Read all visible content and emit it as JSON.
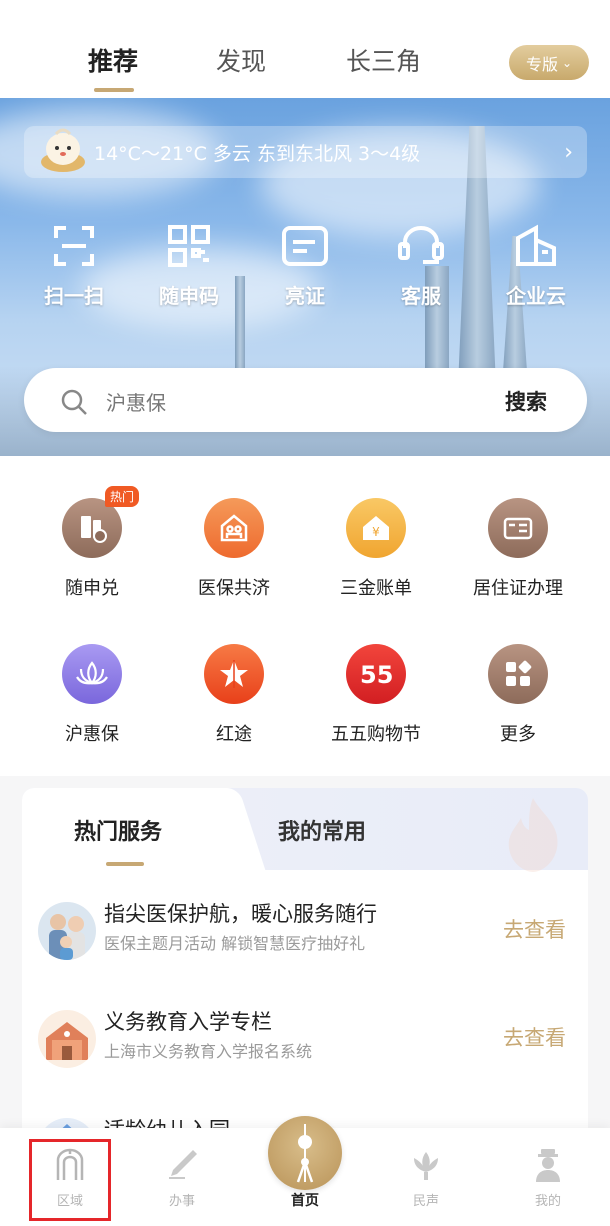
{
  "top_tabs": [
    {
      "label": "推荐",
      "active": true
    },
    {
      "label": "发现",
      "active": false
    },
    {
      "label": "长三角",
      "active": false
    }
  ],
  "edition_button": "专版",
  "weather": {
    "text": "14°C～21°C 多云 东到东北风 3～4级"
  },
  "quick_actions": [
    {
      "label": "扫一扫",
      "icon": "scan-icon"
    },
    {
      "label": "随申码",
      "icon": "qrcode-icon"
    },
    {
      "label": "亮证",
      "icon": "id-card-icon"
    },
    {
      "label": "客服",
      "icon": "customer-service-icon"
    },
    {
      "label": "企业云",
      "icon": "building-icon"
    }
  ],
  "search": {
    "placeholder": "沪惠保",
    "button": "搜索"
  },
  "services": [
    {
      "label": "随申兑",
      "icon": "voucher-icon",
      "badge": "热门",
      "color": "#9b7a66"
    },
    {
      "label": "医保共济",
      "icon": "family-care-icon",
      "color": "#f07a3c"
    },
    {
      "label": "三金账单",
      "icon": "yuan-house-icon",
      "color": "#f3b03b"
    },
    {
      "label": "居住证办理",
      "icon": "residence-card-icon",
      "color": "#9b7a66"
    },
    {
      "label": "沪惠保",
      "icon": "lotus-icon",
      "color": "#8c7be6"
    },
    {
      "label": "红途",
      "icon": "red-star-icon",
      "color": "#ef4b1f"
    },
    {
      "label": "五五购物节",
      "icon": "shopping-festival-icon",
      "color": "#e8302f"
    },
    {
      "label": "更多",
      "icon": "more-grid-icon",
      "color": "#9b7a66"
    }
  ],
  "card": {
    "tabs": [
      {
        "label": "热门服务"
      },
      {
        "label": "我的常用"
      }
    ],
    "items": [
      {
        "title": "指尖医保护航，暖心服务随行",
        "subtitle": "医保主题月活动 解锁智慧医疗抽好礼",
        "action": "去查看"
      },
      {
        "title": "义务教育入学专栏",
        "subtitle": "上海市义务教育入学报名系统",
        "action": "去查看"
      },
      {
        "title": "适龄幼儿入园",
        "subtitle": "",
        "action": ""
      }
    ]
  },
  "bottom_nav": [
    {
      "label": "区域",
      "icon": "arch-icon"
    },
    {
      "label": "办事",
      "icon": "pen-icon"
    },
    {
      "label": "首页",
      "icon": "pearl-tower-icon"
    },
    {
      "label": "民声",
      "icon": "flower-icon"
    },
    {
      "label": "我的",
      "icon": "person-icon"
    }
  ],
  "colors": {
    "accent_gold": "#c7a874",
    "highlight_red": "#e5262a"
  }
}
